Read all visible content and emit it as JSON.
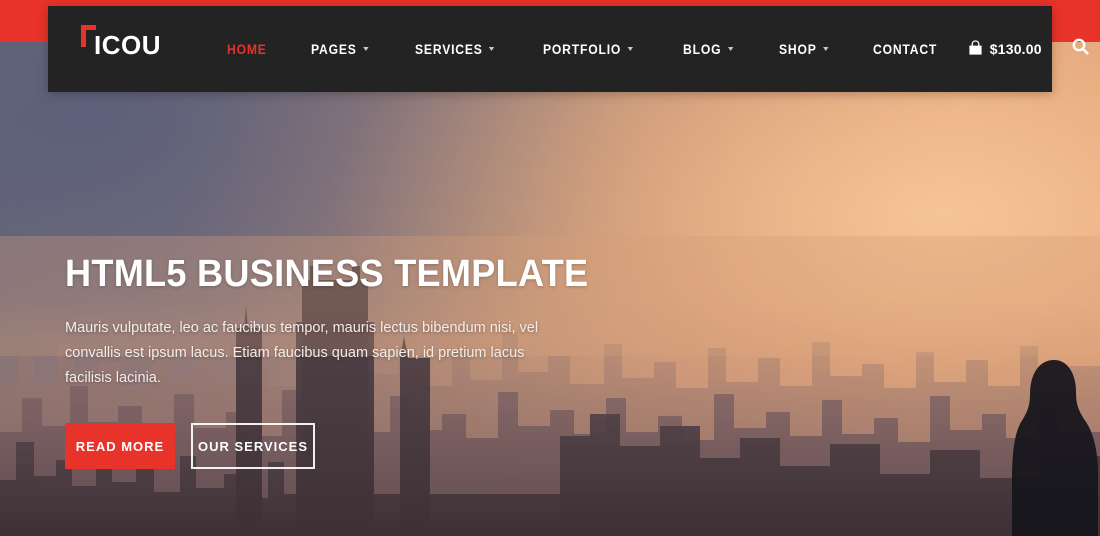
{
  "brand": {
    "logo_text": "ICOU",
    "logo_mark": "corner-bracket-icon",
    "accent_color": "#e8332a",
    "nav_background": "#232323"
  },
  "nav": {
    "items": [
      {
        "label": "HOME",
        "active": true,
        "has_dropdown": false
      },
      {
        "label": "PAGES",
        "active": false,
        "has_dropdown": true
      },
      {
        "label": "SERVICES",
        "active": false,
        "has_dropdown": true
      },
      {
        "label": "PORTFOLIO",
        "active": false,
        "has_dropdown": true
      },
      {
        "label": "BLOG",
        "active": false,
        "has_dropdown": true
      },
      {
        "label": "SHOP",
        "active": false,
        "has_dropdown": true
      },
      {
        "label": "CONTACT",
        "active": false,
        "has_dropdown": false
      }
    ],
    "cart": {
      "icon": "shopping-bag-icon",
      "amount": "$130.00"
    },
    "search": {
      "icon": "search-icon"
    }
  },
  "hero": {
    "title": "HTML5 BUSINESS TEMPLATE",
    "description": "Mauris vulputate, leo ac faucibus tempor, mauris lectus bibendum nisi, vel convallis est ipsum lacus. Etiam faucibus quam sapien, id pretium lacus facilisis lacinia.",
    "primary_button": "READ MORE",
    "secondary_button": "OUR SERVICES"
  }
}
